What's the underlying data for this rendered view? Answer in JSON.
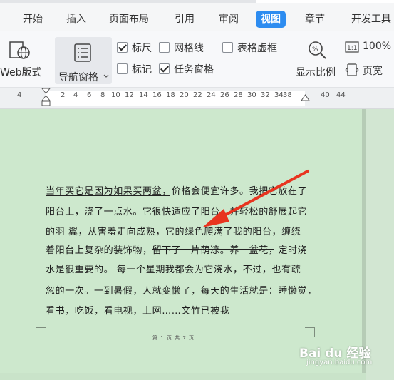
{
  "menu": {
    "tabs": [
      {
        "label": "开始"
      },
      {
        "label": "插入"
      },
      {
        "label": "页面布局"
      },
      {
        "label": "引用"
      },
      {
        "label": "审阅"
      },
      {
        "label": "视图"
      },
      {
        "label": "章节"
      },
      {
        "label": "开发工具"
      }
    ],
    "active_tab": "视图",
    "accent_color": "#2d8cf0"
  },
  "ribbon": {
    "web_layout_label": "Web版式",
    "nav_pane_label": "导航窗格",
    "checkboxes": [
      {
        "label": "标尺",
        "checked": true
      },
      {
        "label": "网格线",
        "checked": false
      },
      {
        "label": "表格虚框",
        "checked": false
      },
      {
        "label": "标记",
        "checked": false
      },
      {
        "label": "任务窗格",
        "checked": true
      }
    ],
    "zoom_label": "显示比例",
    "hundred_percent_label": "100%",
    "page_width_label": "页宽"
  },
  "ruler": {
    "numbers": [
      "4",
      "2",
      "2",
      "4",
      "6",
      "8",
      "10",
      "12",
      "14",
      "16",
      "18",
      "20",
      "22",
      "24",
      "26",
      "28",
      "30",
      "32",
      "34",
      "36",
      "38",
      "40",
      "44"
    ]
  },
  "document": {
    "lines": [
      "当年买它是因为如果买两盆，价格会便宜许多。我把它放在了",
      "阳台上，浇了一点水。它很快适应了阳台，并轻松的舒展起它",
      "的羽  翼，从害羞走向成熟，它的绿色爬满了我的阳台，缠绕",
      "着阳台上复杂的装饰物，留下了一片荫凉。养一盆花，定时浇",
      "水是很重要的。  每一个星期我都会为它浇水，不过，也有疏",
      "忽的一次。一到暑假，人就变懒了，每天的生活就是：睡懒觉，",
      "看书，吃饭，看电视，上网……文竹已被我"
    ],
    "footer": "第 1 页 共 7 页",
    "background_color": "#cde8cd",
    "annotation_color": "#e8341f"
  },
  "watermark": {
    "brand": "Bai du 经验",
    "url": "jingyan.baidu.com"
  }
}
